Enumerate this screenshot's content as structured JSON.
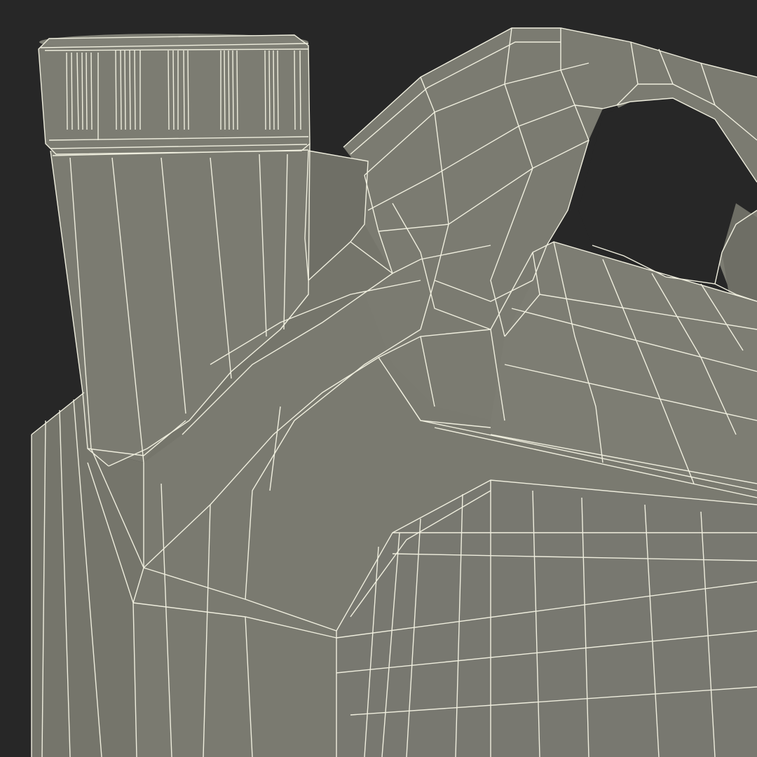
{
  "scene": {
    "background_color": "#272727",
    "surface_color": "#7a7a70",
    "surface_shadow_color": "#6a6a60",
    "surface_light_color": "#85857b",
    "wire_color": "#efeede",
    "subject": "wireframe-jug-with-cap-and-handle"
  }
}
